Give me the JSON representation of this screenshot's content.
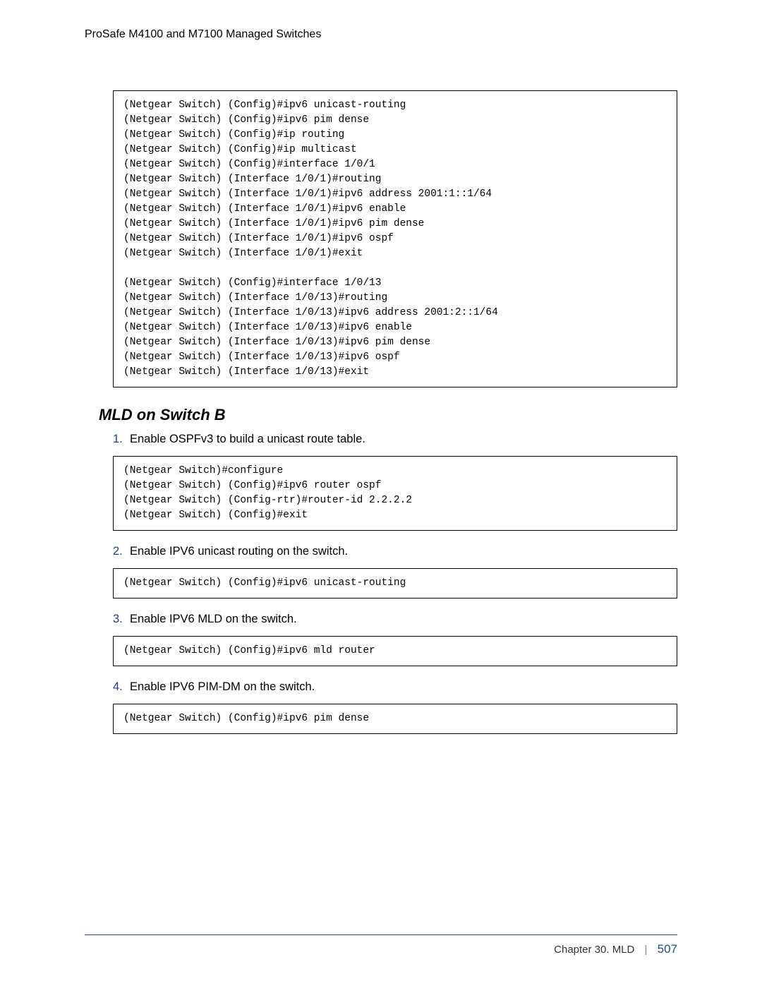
{
  "header": {
    "title": "ProSafe M4100 and M7100 Managed Switches"
  },
  "code_block_1": "(Netgear Switch) (Config)#ipv6 unicast-routing\n(Netgear Switch) (Config)#ipv6 pim dense\n(Netgear Switch) (Config)#ip routing\n(Netgear Switch) (Config)#ip multicast\n(Netgear Switch) (Config)#interface 1/0/1\n(Netgear Switch) (Interface 1/0/1)#routing\n(Netgear Switch) (Interface 1/0/1)#ipv6 address 2001:1::1/64\n(Netgear Switch) (Interface 1/0/1)#ipv6 enable\n(Netgear Switch) (Interface 1/0/1)#ipv6 pim dense\n(Netgear Switch) (Interface 1/0/1)#ipv6 ospf\n(Netgear Switch) (Interface 1/0/1)#exit\n\n(Netgear Switch) (Config)#interface 1/0/13\n(Netgear Switch) (Interface 1/0/13)#routing\n(Netgear Switch) (Interface 1/0/13)#ipv6 address 2001:2::1/64\n(Netgear Switch) (Interface 1/0/13)#ipv6 enable\n(Netgear Switch) (Interface 1/0/13)#ipv6 pim dense\n(Netgear Switch) (Interface 1/0/13)#ipv6 ospf\n(Netgear Switch) (Interface 1/0/13)#exit",
  "section_heading": "MLD on Switch B",
  "steps": {
    "s1": {
      "num": "1.",
      "text": "Enable OSPFv3 to build a unicast route table."
    },
    "s2": {
      "num": "2.",
      "text": "Enable IPV6 unicast routing on the switch."
    },
    "s3": {
      "num": "3.",
      "text": "Enable IPV6 MLD on the switch."
    },
    "s4": {
      "num": "4.",
      "text": "Enable IPV6 PIM-DM on the switch."
    }
  },
  "code_block_2": "(Netgear Switch)#configure\n(Netgear Switch) (Config)#ipv6 router ospf\n(Netgear Switch) (Config-rtr)#router-id 2.2.2.2\n(Netgear Switch) (Config)#exit",
  "code_block_3": "(Netgear Switch) (Config)#ipv6 unicast-routing",
  "code_block_4": "(Netgear Switch) (Config)#ipv6 mld router",
  "code_block_5": "(Netgear Switch) (Config)#ipv6 pim dense",
  "footer": {
    "chapter": "Chapter 30.  MLD",
    "divider": "|",
    "page": "507"
  }
}
